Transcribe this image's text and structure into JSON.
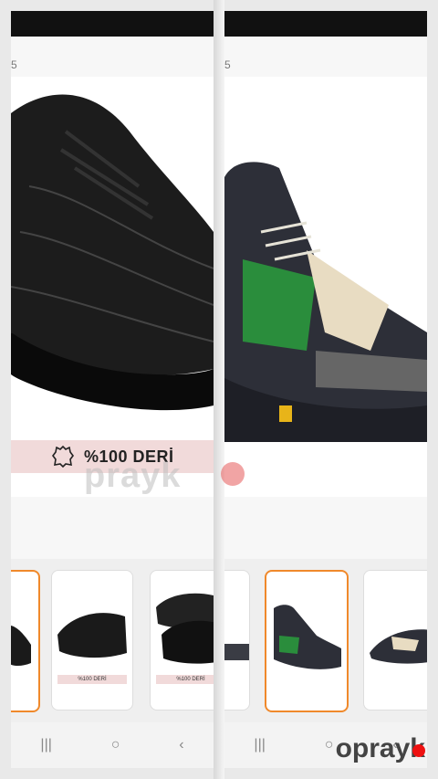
{
  "left": {
    "page_indicator": "5",
    "badge_text": "%100 DERİ",
    "thumbs": [
      {
        "label": ""
      },
      {
        "label": "%100 DERİ"
      },
      {
        "label": "%100 DERİ"
      }
    ]
  },
  "right": {
    "page_indicator": "5",
    "thumbs": [
      {
        "label": ""
      },
      {
        "label": ""
      },
      {
        "label": ""
      }
    ]
  },
  "nav": {
    "recent": "|||",
    "home": "○",
    "back": "‹"
  },
  "brand": {
    "watermark": "prayk",
    "bottom_brand": "oprayk"
  },
  "colors": {
    "accent_orange": "#f0892b",
    "badge_bg": "#f1dada",
    "watermark_dot": "#e65a5a",
    "brand_red": "#e11111"
  }
}
